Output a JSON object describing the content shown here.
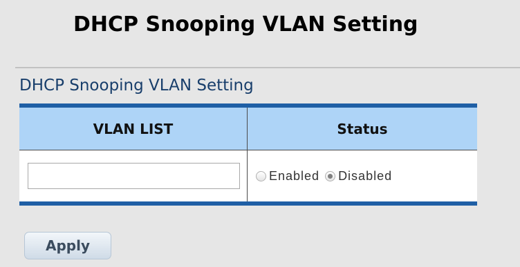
{
  "page": {
    "title": "DHCP Snooping VLAN Setting"
  },
  "section": {
    "title": "DHCP Snooping VLAN Setting"
  },
  "table": {
    "columns": [
      "VLAN LIST",
      "Status"
    ],
    "vlan_list_value": "",
    "status_options": [
      {
        "label": "Enabled",
        "checked": false
      },
      {
        "label": "Disabled",
        "checked": true
      }
    ]
  },
  "actions": {
    "apply_label": "Apply"
  },
  "colors": {
    "table_border": "#1f5fa5",
    "header_bg": "#aed4f7",
    "section_title": "#183e6b"
  }
}
